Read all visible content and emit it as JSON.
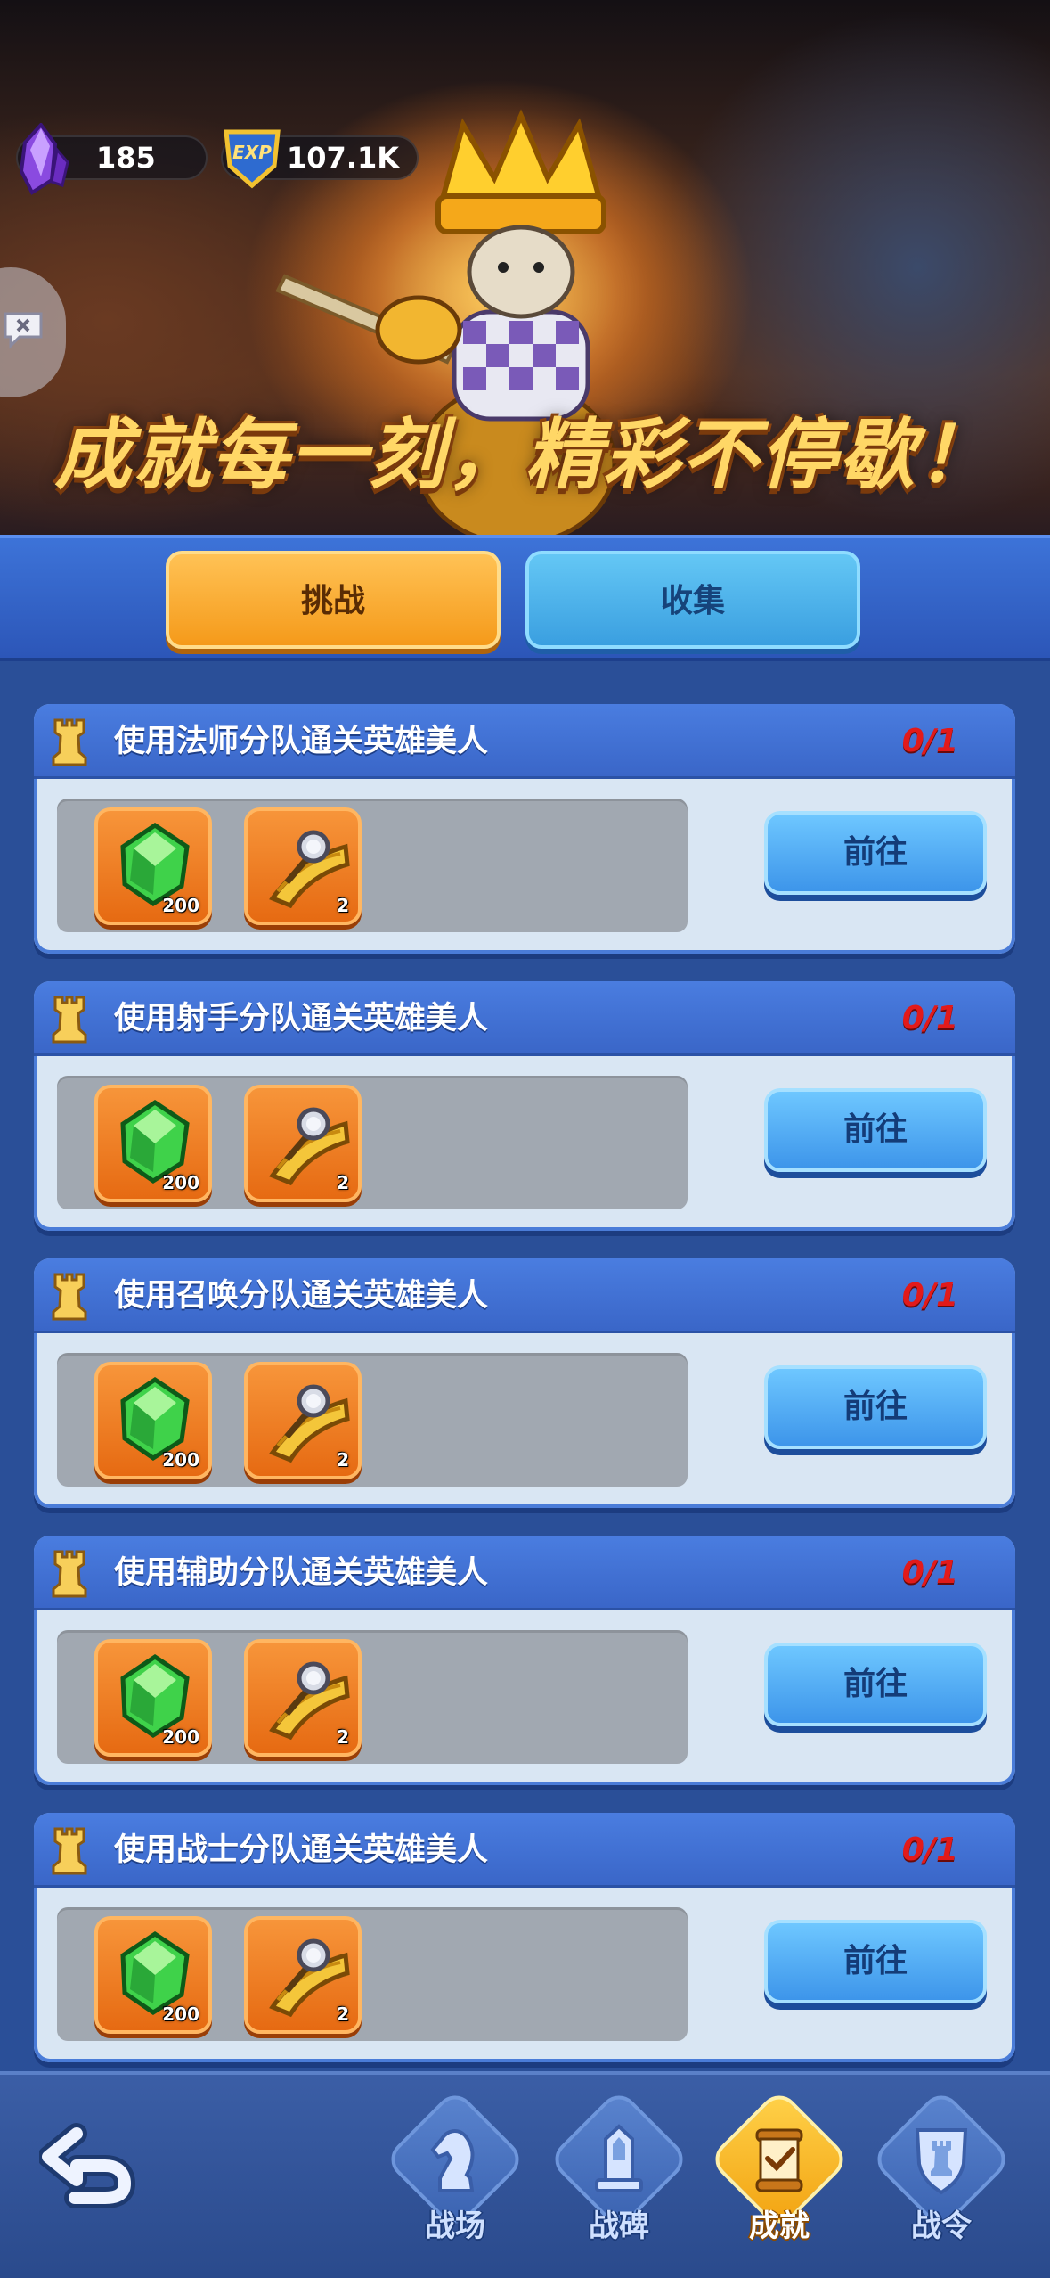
{
  "header": {
    "banner_title": "成就每一刻，精彩不停歇！",
    "gems": "185",
    "exp": "107.1K",
    "exp_icon_text": "EXP"
  },
  "tabs": [
    {
      "label": "挑战",
      "active": true
    },
    {
      "label": "收集",
      "active": false
    }
  ],
  "tasks": [
    {
      "title": "使用法师分队通关英雄美人",
      "progress": "0/1",
      "rewards": [
        {
          "icon": "green-gem-icon",
          "qty": "200"
        },
        {
          "icon": "scroll-key-icon",
          "qty": "2"
        }
      ],
      "button": "前往"
    },
    {
      "title": "使用射手分队通关英雄美人",
      "progress": "0/1",
      "rewards": [
        {
          "icon": "green-gem-icon",
          "qty": "200"
        },
        {
          "icon": "scroll-key-icon",
          "qty": "2"
        }
      ],
      "button": "前往"
    },
    {
      "title": "使用召唤分队通关英雄美人",
      "progress": "0/1",
      "rewards": [
        {
          "icon": "green-gem-icon",
          "qty": "200"
        },
        {
          "icon": "scroll-key-icon",
          "qty": "2"
        }
      ],
      "button": "前往"
    },
    {
      "title": "使用辅助分队通关英雄美人",
      "progress": "0/1",
      "rewards": [
        {
          "icon": "green-gem-icon",
          "qty": "200"
        },
        {
          "icon": "scroll-key-icon",
          "qty": "2"
        }
      ],
      "button": "前往"
    },
    {
      "title": "使用战士分队通关英雄美人",
      "progress": "0/1",
      "rewards": [
        {
          "icon": "green-gem-icon",
          "qty": "200"
        },
        {
          "icon": "scroll-key-icon",
          "qty": "2"
        }
      ],
      "button": "前往"
    }
  ],
  "bottom_nav": [
    {
      "label": "战场",
      "icon": "knight-icon",
      "active": false
    },
    {
      "label": "战碑",
      "icon": "monument-icon",
      "active": false
    },
    {
      "label": "成就",
      "icon": "scroll-check-icon",
      "active": true
    },
    {
      "label": "战令",
      "icon": "rook-shield-icon",
      "active": false
    }
  ],
  "colors": {
    "page_bg": "#2a4f98",
    "progress_red": "#e21a1a",
    "tab_active": "#f59a1a",
    "tab_inactive": "#3a9fe0"
  }
}
